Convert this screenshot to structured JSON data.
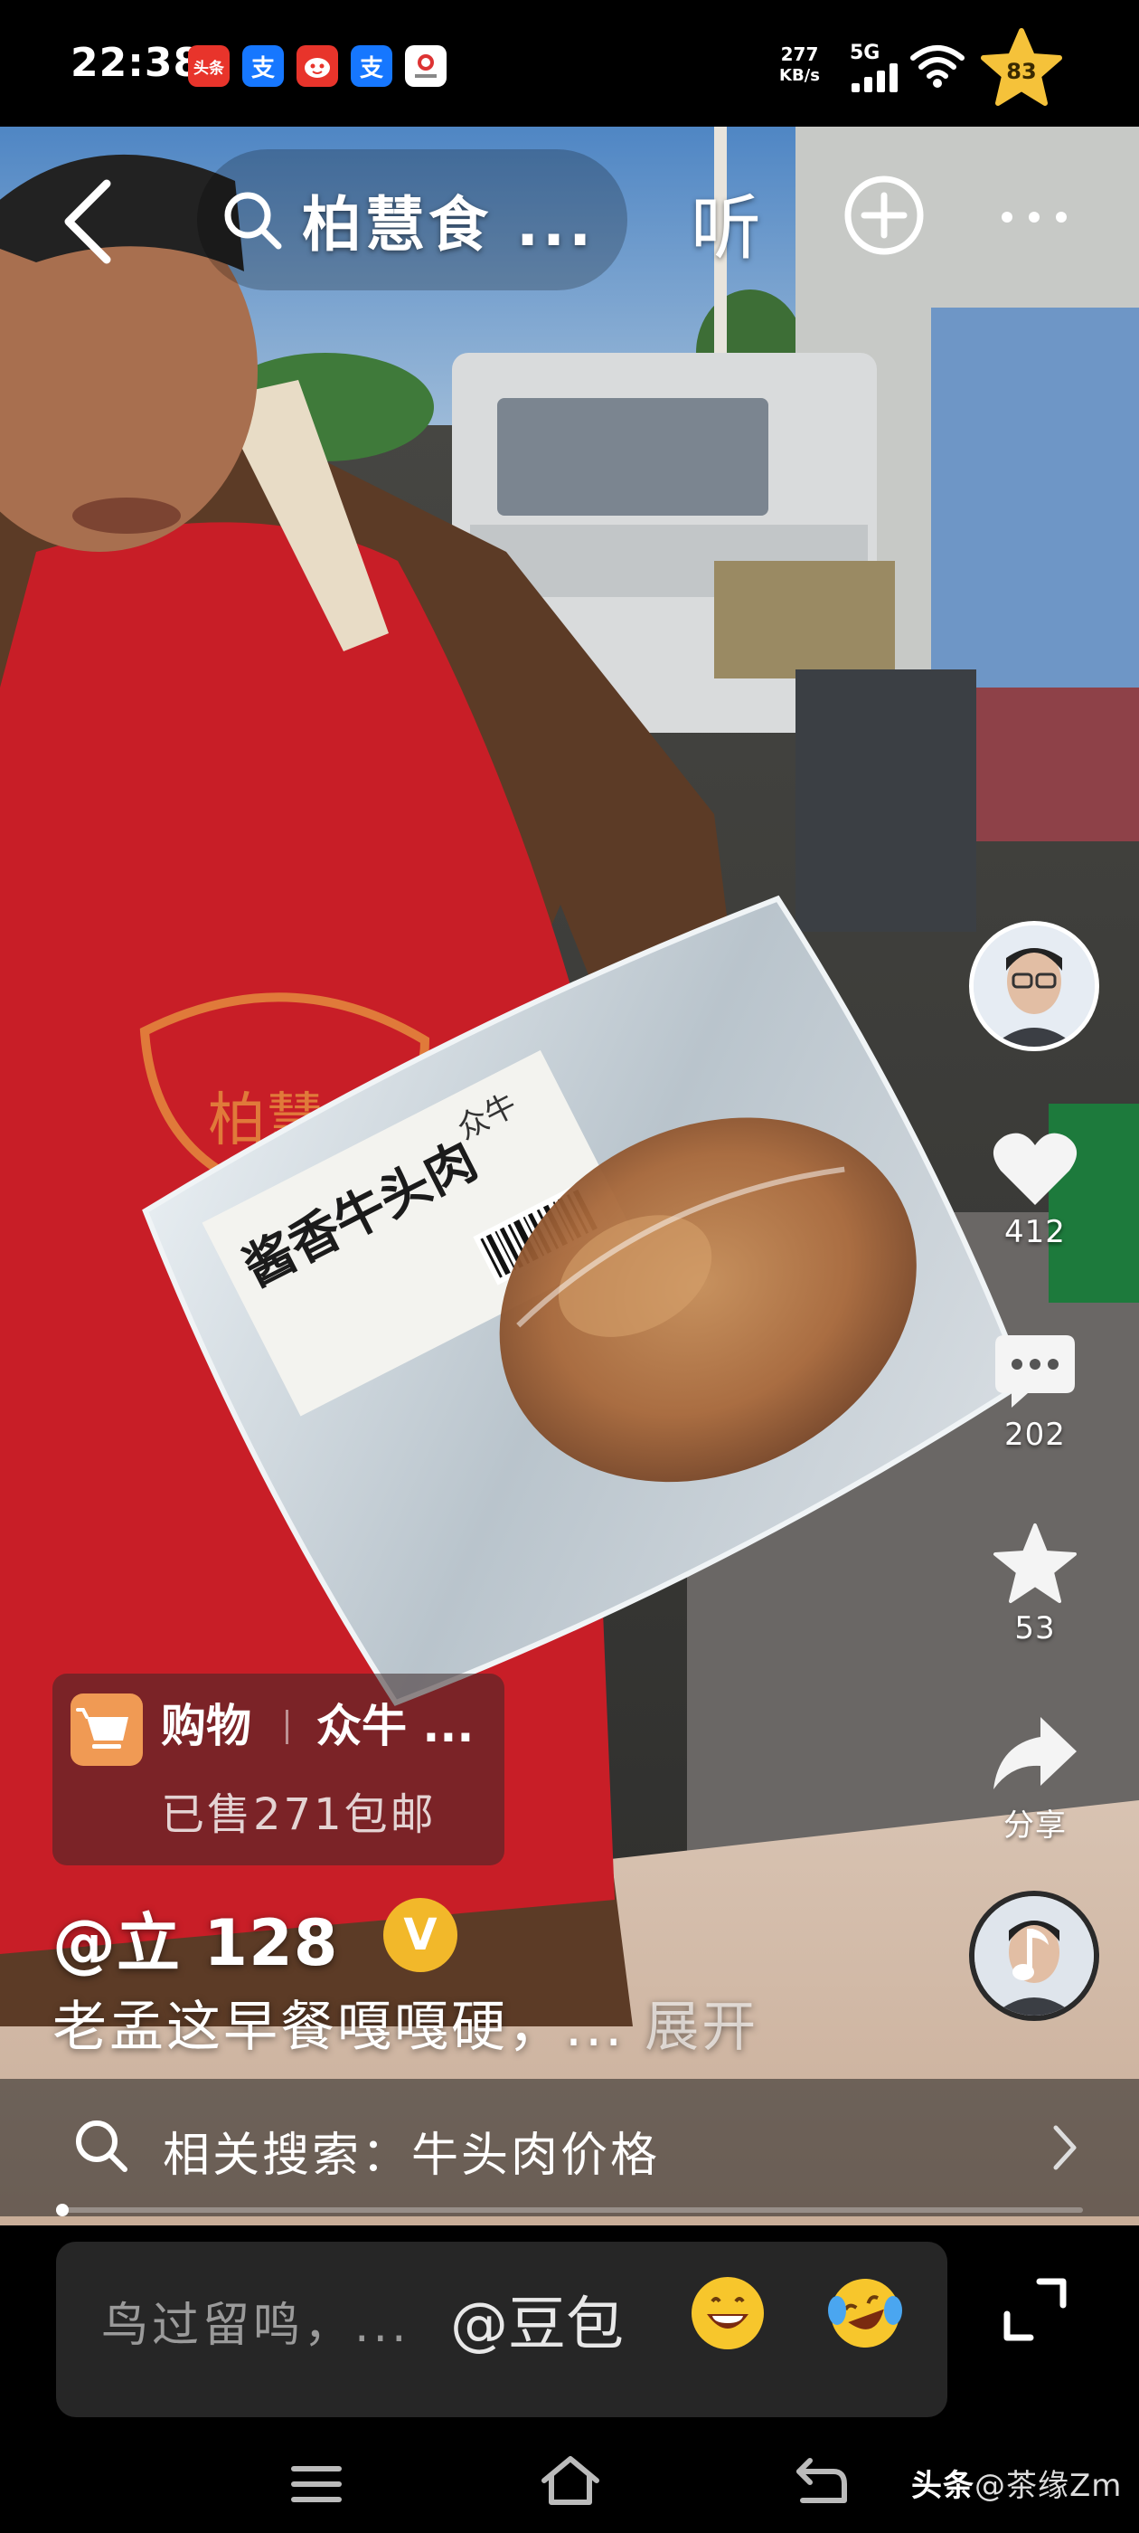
{
  "status_bar": {
    "time": "22:38",
    "apps": [
      {
        "name": "toutiao-app-icon",
        "label": "头条",
        "color": "#e8342b"
      },
      {
        "name": "alipay-app-icon",
        "label": "支",
        "color": "#1677ff"
      },
      {
        "name": "pinduoduo-app-icon",
        "label": "",
        "color": "#e8342b"
      },
      {
        "name": "alipay-app-icon-2",
        "label": "支",
        "color": "#1677ff"
      },
      {
        "name": "news-app-icon",
        "label": "",
        "color": "#ffffff"
      }
    ],
    "net_speed_value": "277",
    "net_speed_unit": "KB/s",
    "network": "5G",
    "battery": "83",
    "battery_color": "#f5c23a"
  },
  "top_bar": {
    "search_query": "柏慧食 ...",
    "listen_label": "听"
  },
  "actions": {
    "like_count": "412",
    "comment_count": "202",
    "favorite_count": "53",
    "share_label": "分享"
  },
  "shop": {
    "label": "购物",
    "title": "众牛 ...",
    "subtitle": "已售271包邮",
    "icon_color": "#f09a54"
  },
  "video_text": {
    "bag_label": "酱香牛头肉",
    "bag_brand": "众牛",
    "apron_text": "柏慧"
  },
  "caption": {
    "author": "@立 128",
    "verified_mark": "V",
    "description": "老孟这早餐嘎嘎硬，...",
    "expand_label": "展开"
  },
  "related_search": {
    "text": "相关搜索：牛头肉价格"
  },
  "comment_bar": {
    "placeholder": "鸟过留鸣，...",
    "mention": "@豆包"
  },
  "watermark": {
    "brand": "头条",
    "handle": "@茶缘Zm"
  }
}
